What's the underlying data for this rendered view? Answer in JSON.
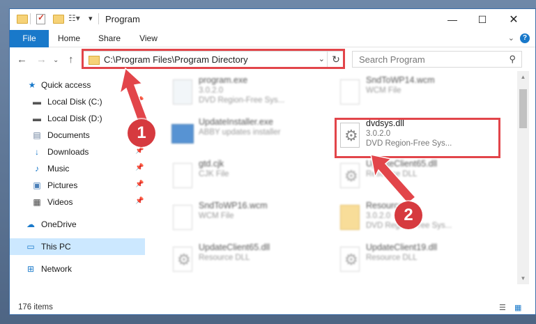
{
  "window": {
    "title": "Program"
  },
  "ribbon": {
    "tabs": [
      "File",
      "Home",
      "Share",
      "View"
    ],
    "help": "?"
  },
  "address": {
    "path": "C:\\Program Files\\Program Directory"
  },
  "search": {
    "placeholder": "Search Program"
  },
  "sidebar": {
    "items": [
      {
        "label": "Quick access",
        "icon": "star-icon",
        "pinned": false
      },
      {
        "label": "Local Disk (C:)",
        "icon": "drive-icon",
        "pinned": true
      },
      {
        "label": "Local Disk (D:)",
        "icon": "drive-icon",
        "pinned": false
      },
      {
        "label": "Documents",
        "icon": "documents-icon",
        "pinned": true
      },
      {
        "label": "Downloads",
        "icon": "download-icon",
        "pinned": true
      },
      {
        "label": "Music",
        "icon": "music-icon",
        "pinned": true
      },
      {
        "label": "Pictures",
        "icon": "pictures-icon",
        "pinned": true
      },
      {
        "label": "Videos",
        "icon": "videos-icon",
        "pinned": true
      },
      {
        "label": "OneDrive",
        "icon": "cloud-icon",
        "pinned": false
      },
      {
        "label": "This PC",
        "icon": "computer-icon",
        "pinned": false,
        "selected": true
      },
      {
        "label": "Network",
        "icon": "network-icon",
        "pinned": false
      }
    ]
  },
  "files": {
    "left": [
      {
        "name": "program.exe",
        "line1": "3.0.2.0",
        "line2": "DVD Region-Free Sys...",
        "icon": "exe-icon"
      },
      {
        "name": "UpdateInstaller.exe",
        "line1": "ABBY updates installer",
        "line2": "",
        "icon": "installer-icon"
      },
      {
        "name": "gtd.cjk",
        "line1": "CJK File",
        "line2": "",
        "icon": "file-icon"
      },
      {
        "name": "SndToWP16.wcm",
        "line1": "WCM File",
        "line2": "",
        "icon": "file-icon"
      },
      {
        "name": "UpdateClient65.dll",
        "line1": "Resource DLL",
        "line2": "",
        "icon": "dll-icon"
      }
    ],
    "right": [
      {
        "name": "SndToWP14.wcm",
        "line1": "WCM File",
        "line2": "",
        "icon": "file-icon"
      },
      {
        "name": "dvdsys.dll",
        "line1": "3.0.2.0",
        "line2": "DVD Region-Free Sys...",
        "icon": "dll-icon"
      },
      {
        "name": "UpdateClient65.dll",
        "line1": "Resource DLL",
        "line2": "",
        "icon": "dll-icon"
      },
      {
        "name": "Resource",
        "line1": "3.0.2.0",
        "line2": "DVD Region-Free Sys...",
        "icon": "folder-icon"
      },
      {
        "name": "UpdateClient19.dll",
        "line1": "Resource DLL",
        "line2": "",
        "icon": "dll-icon"
      }
    ]
  },
  "status": {
    "items": "176 items"
  },
  "annotations": {
    "badge1": "1",
    "badge2": "2",
    "accent": "#e2454a"
  }
}
